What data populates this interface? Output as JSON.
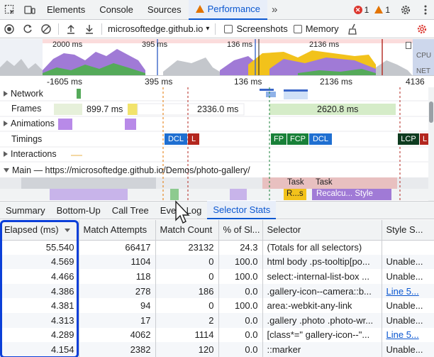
{
  "tabs": {
    "elements": "Elements",
    "console": "Console",
    "sources": "Sources",
    "performance": "Performance",
    "more": "»",
    "error_count": "1",
    "warning_count": "1"
  },
  "toolbar": {
    "url": "microsoftedge.github.io",
    "screenshots": "Screenshots",
    "memory": "Memory"
  },
  "overview": {
    "labels": [
      "2000 ms",
      "395 ms",
      "136 ms",
      "2136 ms"
    ],
    "cpu": "CPU",
    "net": "NET"
  },
  "ruler": [
    "-1605 ms",
    "395 ms",
    "136 ms",
    "2136 ms",
    "4136"
  ],
  "tracks": {
    "network": "Network",
    "frames": "Frames",
    "frame_times": [
      "899.7 ms",
      "2336.0 ms",
      "2620.8 ms"
    ],
    "animations": "Animations",
    "timings": "Timings",
    "timing_markers": [
      "DCL",
      "L",
      "FP",
      "FCP",
      "DCL",
      "LCP",
      "L"
    ],
    "interactions": "Interactions",
    "main": "Main — https://microsoftedge.github.io/Demos/photo-gallery/",
    "main_tasks": [
      "Task",
      "Task",
      "R...s",
      "Recalcu... Style"
    ]
  },
  "bottom_tabs": [
    "Summary",
    "Bottom-Up",
    "Call Tree",
    "Event Log",
    "Selector Stats"
  ],
  "selector_stats": {
    "columns": [
      "Elapsed (ms)",
      "Match Attempts",
      "Match Count",
      "% of Sl...",
      "Selector",
      "Style S..."
    ],
    "rows": [
      [
        "55.540",
        "66417",
        "23132",
        "24.3",
        "(Totals for all selectors)",
        ""
      ],
      [
        "4.569",
        "1104",
        "0",
        "100.0",
        "html body .ps-tooltip[po...",
        "Unable..."
      ],
      [
        "4.466",
        "118",
        "0",
        "100.0",
        "select:-internal-list-box ...",
        "Unable..."
      ],
      [
        "4.386",
        "278",
        "186",
        "0.0",
        ".gallery-icon--camera::b...",
        "Line 5..."
      ],
      [
        "4.381",
        "94",
        "0",
        "100.0",
        "area:-webkit-any-link",
        "Unable..."
      ],
      [
        "4.313",
        "17",
        "2",
        "0.0",
        ".gallery .photo .photo-wr...",
        "Unable..."
      ],
      [
        "4.289",
        "4062",
        "1114",
        "0.0",
        "[class*=\" gallery-icon--\"...",
        "Line 5..."
      ],
      [
        "4.154",
        "2382",
        "120",
        "0.0",
        "::marker",
        "Unable..."
      ]
    ]
  },
  "colors": {
    "accent": "#0b57d0",
    "focus": "#0b3fd8",
    "dcl": "#1f6fd1",
    "load": "#b3261e",
    "fp": "#188038",
    "lcp": "#0d3b1f"
  }
}
